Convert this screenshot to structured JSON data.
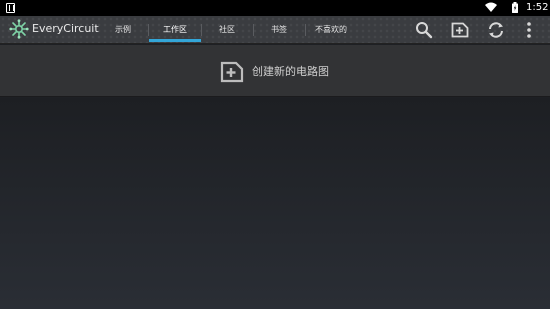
{
  "status_bar": {
    "notification_icon": "notification-a-icon",
    "wifi_icon": "wifi-icon",
    "battery_icon": "battery-charging-icon",
    "time": "1:52"
  },
  "app_bar": {
    "logo_icon": "everycircuit-logo-icon",
    "title": "EveryCircuit",
    "tabs": [
      {
        "label": "示例",
        "active": false
      },
      {
        "label": "工作区",
        "active": true
      },
      {
        "label": "社区",
        "active": false
      },
      {
        "label": "书签",
        "active": false
      },
      {
        "label": "不喜欢的",
        "active": false
      }
    ],
    "actions": [
      "search-icon",
      "new-circuit-icon",
      "sync-icon",
      "overflow-menu-icon"
    ],
    "accent_color": "#33a6d8"
  },
  "content": {
    "new_circuit_label": "创建新的电路图",
    "new_circuit_icon": "new-circuit-icon"
  }
}
